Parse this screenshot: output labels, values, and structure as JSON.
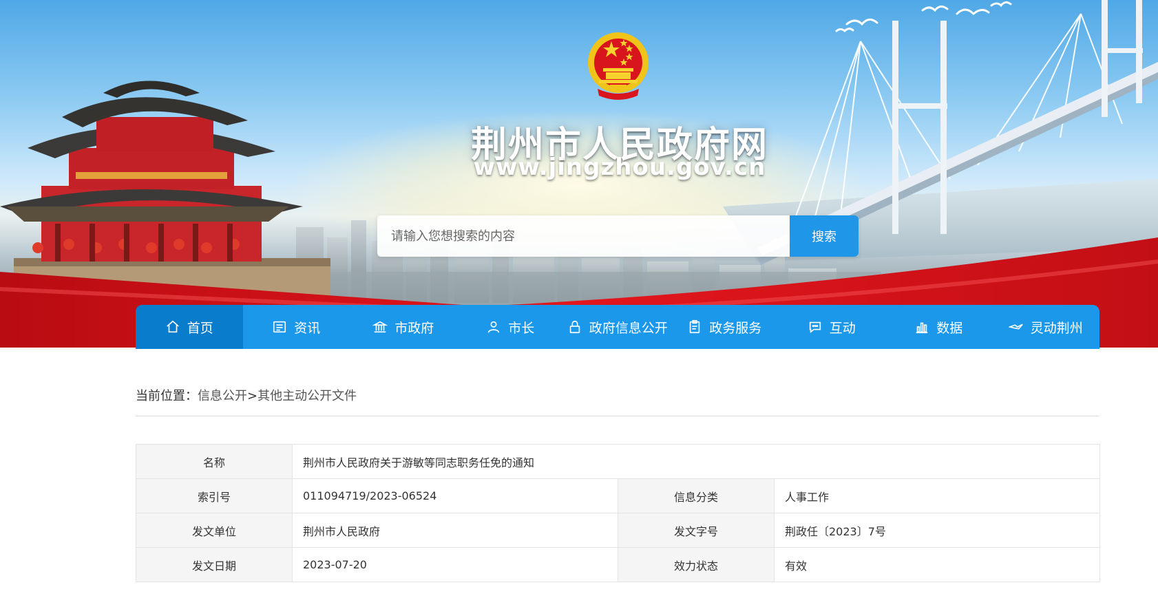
{
  "header": {
    "site_title": "荆州市人民政府网",
    "site_url": "www.jingzhou.gov.cn",
    "emblem_icon": "national-emblem-icon"
  },
  "search": {
    "placeholder": "请输入您想搜索的内容",
    "value": "",
    "button_label": "搜索"
  },
  "nav": {
    "items": [
      {
        "label": "首页",
        "icon": "home-icon",
        "active": true
      },
      {
        "label": "资讯",
        "icon": "news-icon"
      },
      {
        "label": "市政府",
        "icon": "government-building-icon"
      },
      {
        "label": "市长",
        "icon": "person-icon"
      },
      {
        "label": "政府信息公开",
        "icon": "lock-icon"
      },
      {
        "label": "政务服务",
        "icon": "clipboard-icon"
      },
      {
        "label": "互动",
        "icon": "chat-icon"
      },
      {
        "label": "数据",
        "icon": "bar-chart-icon"
      },
      {
        "label": "灵动荆州",
        "icon": "bird-icon"
      }
    ]
  },
  "breadcrumb": {
    "prefix": "当前位置：",
    "level1": "信息公开",
    "separator": ">",
    "level2": "其他主动公开文件"
  },
  "doc_info": {
    "name_label": "名称",
    "name_value": "荆州市人民政府关于游敏等同志职务任免的通知",
    "index_label": "索引号",
    "index_value": "011094719/2023-06524",
    "category_label": "信息分类",
    "category_value": "人事工作",
    "issuer_label": "发文单位",
    "issuer_value": "荆州市人民政府",
    "docno_label": "发文字号",
    "docno_value": "荆政任〔2023〕7号",
    "date_label": "发文日期",
    "date_value": "2023-07-20",
    "status_label": "效力状态",
    "status_value": "有效"
  },
  "colors": {
    "nav_bg": "#1b98e9",
    "nav_active": "#0a7ccc",
    "search_button": "#1f96e8",
    "ribbon_red": "#d8141c"
  }
}
